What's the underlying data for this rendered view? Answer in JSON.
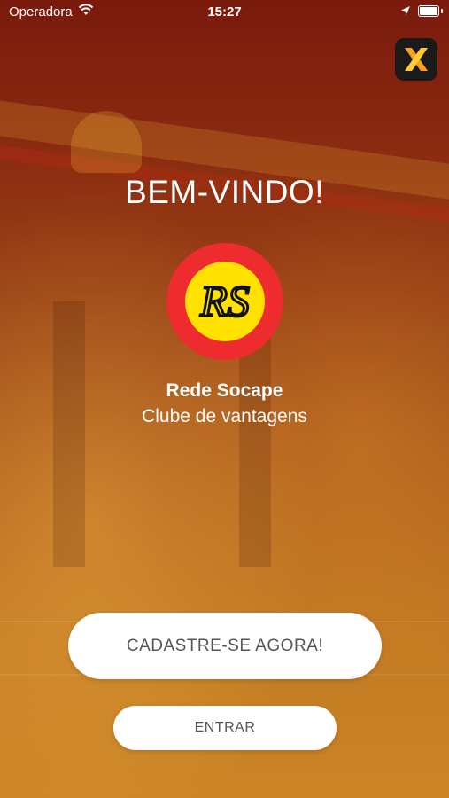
{
  "status_bar": {
    "carrier": "Operadora",
    "time": "15:27"
  },
  "welcome": {
    "title": "BEM-VINDO!"
  },
  "brand": {
    "logo_text": "RS",
    "name": "Rede Socape",
    "tagline": "Clube de vantagens"
  },
  "actions": {
    "register_label": "CADASTRE-SE AGORA!",
    "login_label": "ENTRAR"
  },
  "colors": {
    "logo_ring": "#ee2b2f",
    "logo_center": "#ffe100",
    "app_icon_accent": "#f7a31c",
    "button_text": "#555555"
  },
  "icons": [
    "wifi-icon",
    "location-arrow-icon",
    "battery-icon",
    "app-x-icon"
  ]
}
